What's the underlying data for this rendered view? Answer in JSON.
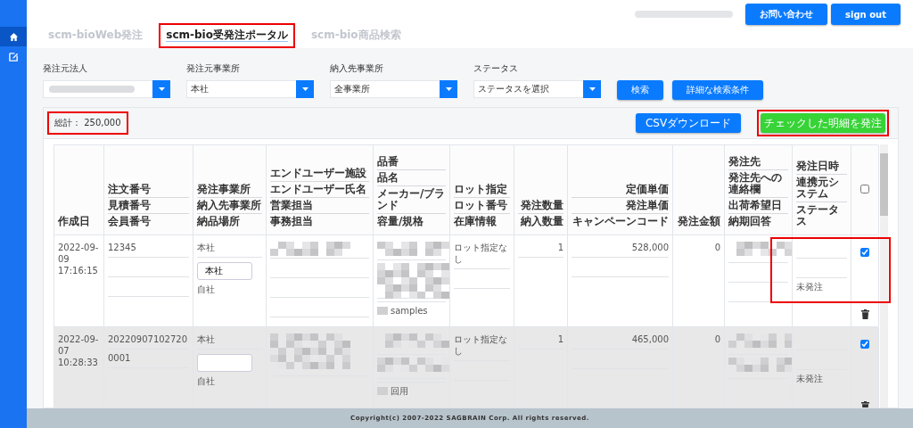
{
  "sidebar": {
    "items": [
      {
        "kind": "home",
        "selected": true
      },
      {
        "kind": "edit",
        "selected": false
      }
    ]
  },
  "header": {
    "buttons": [
      "お問い合わせ",
      "sign out"
    ]
  },
  "tabs": [
    {
      "label": "scm-bioWeb発注",
      "selected": false,
      "highlighted": false
    },
    {
      "label": "scm-bio受発注ポータル",
      "selected": true,
      "highlighted": true
    },
    {
      "label": "scm-bio商品検索",
      "selected": false,
      "highlighted": false
    }
  ],
  "filters": [
    {
      "label": "発注元法人",
      "redacted": true
    },
    {
      "label": "発注元事業所",
      "value": "本社",
      "redacted": false
    },
    {
      "label": "納入先事業所",
      "value": "全事業所",
      "redacted": false
    },
    {
      "label": "ステータス",
      "value": "ステータスを選択",
      "redacted": false
    }
  ],
  "filter_buttons": [
    "検索",
    "詳細な検索条件"
  ],
  "total": {
    "text": "総計： 250,000",
    "highlighted": true
  },
  "actions": [
    {
      "label": "CSVダウンロード",
      "kind": "primary",
      "highlighted": false
    },
    {
      "label": "チェックした明細を発注",
      "kind": "success",
      "highlighted": true
    }
  ],
  "table": {
    "columns": [
      {
        "lines": [
          "作成日"
        ],
        "kind": "text"
      },
      {
        "lines": [
          "注文番号",
          "見積番号",
          "会員番号"
        ],
        "kind": "text"
      },
      {
        "lines": [
          "発注事業所",
          "納入先事業所",
          "納品場所"
        ],
        "kind": "text"
      },
      {
        "lines": [
          "エンドユーザー施設",
          "エンドユーザー氏名",
          "営業担当",
          "事務担当"
        ],
        "kind": "text"
      },
      {
        "lines": [
          "品番",
          "品名",
          "メーカー/ブランド",
          "容量/規格"
        ],
        "kind": "text"
      },
      {
        "lines": [
          "ロット指定",
          "ロット番号",
          "在庫情報"
        ],
        "kind": "text"
      },
      {
        "lines": [
          "発注数量",
          "納入数量"
        ],
        "kind": "number"
      },
      {
        "lines": [
          "定価単価",
          "発注単価",
          "キャンペーンコード"
        ],
        "kind": "number"
      },
      {
        "lines": [
          "発注金額"
        ],
        "kind": "number"
      },
      {
        "lines": [
          "発注先",
          "発注先への連絡欄",
          "出荷希望日",
          "納期回答"
        ],
        "kind": "text"
      },
      {
        "lines": [
          "発注日時",
          "連携元システム",
          "ステータス"
        ],
        "kind": "text"
      },
      {
        "kind": "select",
        "header_checkbox": {
          "checked": false
        }
      }
    ],
    "rows": [
      {
        "shaded": false,
        "highlighted": true,
        "cells": [
          [
            {
              "kind": "plain",
              "text": "2022-09-\n09\n17:16:15"
            }
          ],
          [
            {
              "kind": "text",
              "text": "12345"
            },
            {
              "kind": "line"
            },
            {
              "kind": "line"
            }
          ],
          [
            {
              "kind": "text",
              "text": "本社"
            },
            {
              "kind": "input",
              "value": "本社"
            },
            {
              "kind": "plain",
              "text": "自社"
            }
          ],
          [
            {
              "kind": "blur"
            },
            {
              "kind": "line"
            },
            {
              "kind": "line"
            },
            {
              "kind": "line"
            }
          ],
          [
            {
              "kind": "blur"
            },
            {
              "kind": "blur_tall"
            },
            {
              "kind": "blurtext",
              "text": "samples"
            }
          ],
          [
            {
              "kind": "text",
              "text": "ロット指定なし"
            },
            {
              "kind": "line"
            }
          ],
          [
            {
              "kind": "text",
              "text": "1"
            }
          ],
          [
            {
              "kind": "text",
              "text": "528,000"
            },
            {
              "kind": "line"
            }
          ],
          [
            {
              "kind": "plain",
              "text": "0"
            }
          ],
          [
            {
              "kind": "blur"
            },
            {
              "kind": "line"
            },
            {
              "kind": "line"
            }
          ],
          [
            {
              "kind": "line"
            },
            {
              "kind": "line"
            },
            {
              "kind": "plain",
              "text": "未発注"
            }
          ],
          [
            {
              "kind": "checkbox",
              "checked": true
            },
            {
              "kind": "trash"
            }
          ]
        ]
      },
      {
        "shaded": true,
        "highlighted": false,
        "cells": [
          [
            {
              "kind": "plain",
              "text": "2022-09-\n07\n10:28:33"
            }
          ],
          [
            {
              "kind": "text",
              "text": "20220907102720"
            },
            {
              "kind": "text",
              "text": "0001"
            }
          ],
          [
            {
              "kind": "text",
              "text": "本社"
            },
            {
              "kind": "input"
            },
            {
              "kind": "plain",
              "text": "自社"
            }
          ],
          [
            {
              "kind": "blur_tall"
            }
          ],
          [
            {
              "kind": "blur"
            },
            {
              "kind": "blur"
            },
            {
              "kind": "blurtext",
              "text": "回用"
            }
          ],
          [
            {
              "kind": "text",
              "text": "ロット指定なし"
            },
            {
              "kind": "line"
            }
          ],
          [
            {
              "kind": "text",
              "text": "1"
            }
          ],
          [
            {
              "kind": "text",
              "text": "465,000"
            },
            {
              "kind": "line"
            }
          ],
          [
            {
              "kind": "plain",
              "text": "0"
            }
          ],
          [
            {
              "kind": "blur"
            },
            {
              "kind": "blur"
            }
          ],
          [
            {
              "kind": "line"
            },
            {
              "kind": "line"
            },
            {
              "kind": "plain",
              "text": "未発注"
            }
          ],
          [
            {
              "kind": "checkbox",
              "checked": true
            },
            {
              "kind": "trash"
            }
          ]
        ]
      }
    ]
  },
  "footer": "Copyright(c) 2007-2022 SAGBRAIN Corp. All rights reserved."
}
